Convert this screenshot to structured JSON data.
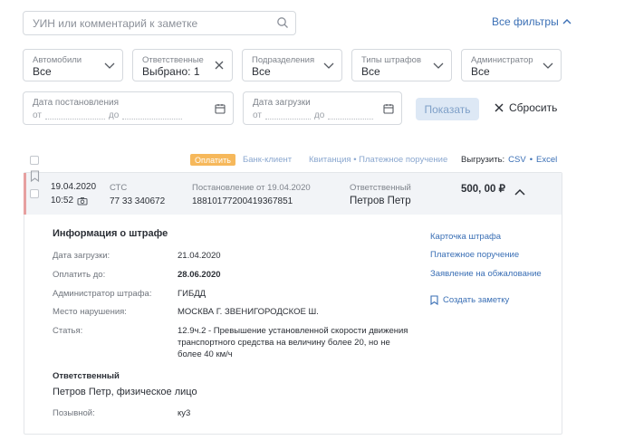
{
  "search": {
    "placeholder": "УИН или комментарий к заметке"
  },
  "all_filters": "Все фильтры",
  "filters": [
    {
      "label": "Автомобили",
      "value": "Все"
    },
    {
      "label": "Ответственные",
      "value": "Выбрано: 1"
    },
    {
      "label": "Подразделения",
      "value": "Все"
    },
    {
      "label": "Типы штрафов",
      "value": "Все"
    },
    {
      "label": "Администратор",
      "value": "Все"
    }
  ],
  "date_filters": [
    {
      "label": "Дата постановления",
      "from": "от",
      "to": "до"
    },
    {
      "label": "Дата загрузки",
      "from": "от",
      "to": "до"
    }
  ],
  "buttons": {
    "show": "Показать",
    "reset": "Сбросить"
  },
  "actions": {
    "pay": "Оплатить",
    "bank_client": "Банк-клиент",
    "receipt": "Квитанция • Платежное поручение",
    "export_label": "Выгрузить:",
    "csv": "CSV",
    "sep": "•",
    "excel": "Excel"
  },
  "fine": {
    "date": "19.04.2020",
    "time": "10:52",
    "sts_label": "СТС",
    "sts": "77 33 340672",
    "decree_label": "Постановление от 19.04.2020",
    "decree_number": "18810177200419367851",
    "responsible_label": "Ответственный",
    "responsible": "Петров Петр",
    "amount": "500, 00 ₽"
  },
  "details": {
    "title": "Информация о штрафе",
    "rows": [
      {
        "label": "Дата загрузки:",
        "value": "21.04.2020"
      },
      {
        "label": "Оплатить до:",
        "value": "28.06.2020"
      },
      {
        "label": "Администратор штрафа:",
        "value": "ГИБДД"
      },
      {
        "label": "Место нарушения:",
        "value": "МОСКВА Г. ЗВЕНИГОРОДСКОЕ Ш."
      },
      {
        "label": "Статья:",
        "value": "12.9ч.2 - Превышение установленной скорости движения транспортного средства на величину более 20, но не более 40 км/ч"
      }
    ],
    "links": [
      "Карточка штрафа",
      "Платежное поручение",
      "Заявление на обжалование"
    ],
    "create_note": "Создать заметку",
    "responsible_title": "Ответственный",
    "responsible_full": "Петров Петр, физическое лицо",
    "callsign_label": "Позывной:",
    "callsign": "ку3"
  }
}
